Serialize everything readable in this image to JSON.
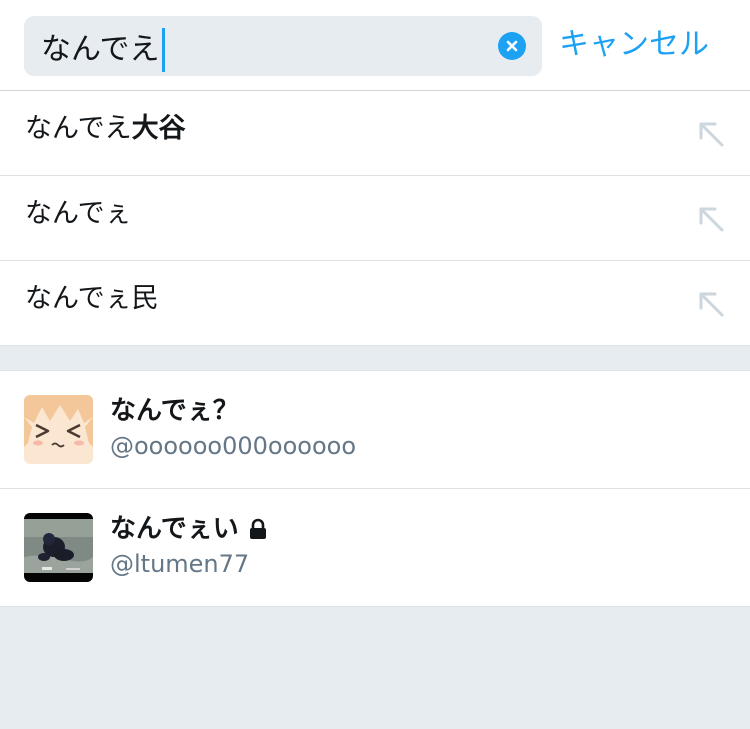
{
  "search": {
    "query": "なんでえ",
    "cancel_label": "キャンセル"
  },
  "suggestions": [
    {
      "prefix": "なんでえ",
      "bold": "大谷"
    },
    {
      "prefix": "なんでぇ",
      "bold": ""
    },
    {
      "prefix": "なんでぇ民",
      "bold": ""
    }
  ],
  "users": [
    {
      "name": "なんでぇ？",
      "handle": "@oooooo000oooooo",
      "protected": false
    },
    {
      "name": "なんでぇい",
      "handle": "@ltumen77",
      "protected": true
    }
  ],
  "colors": {
    "accent": "#1da1f2",
    "background": "#e6ecf0",
    "text": "#14171a",
    "secondary_text": "#657786"
  },
  "icons": {
    "clear": "clear-x-icon",
    "fill_suggestion": "arrow-up-left-icon",
    "protected": "lock-icon"
  }
}
